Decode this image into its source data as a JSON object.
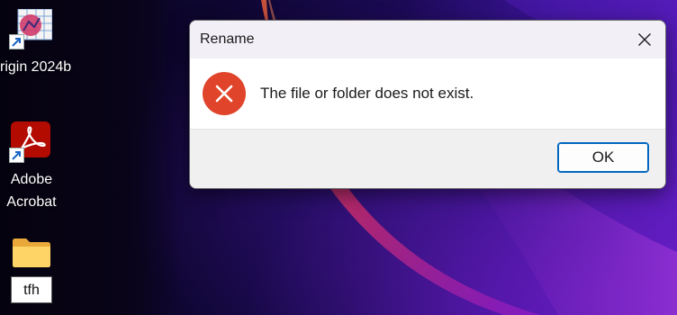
{
  "desktop": {
    "icons": [
      {
        "label": "rigin 2024b",
        "icon": "origin-app-icon"
      },
      {
        "label": "Adobe Acrobat",
        "icon": "adobe-acrobat-icon"
      },
      {
        "label": "tfh",
        "icon": "folder-icon"
      }
    ]
  },
  "dialog": {
    "title": "Rename",
    "message": "The file or folder does not exist.",
    "ok_label": "OK",
    "icons": {
      "error": "error-icon",
      "close": "close-icon"
    }
  },
  "colors": {
    "error_red": "#e0442a",
    "accent": "#0067c0",
    "titlebar": "#f3eff7"
  }
}
